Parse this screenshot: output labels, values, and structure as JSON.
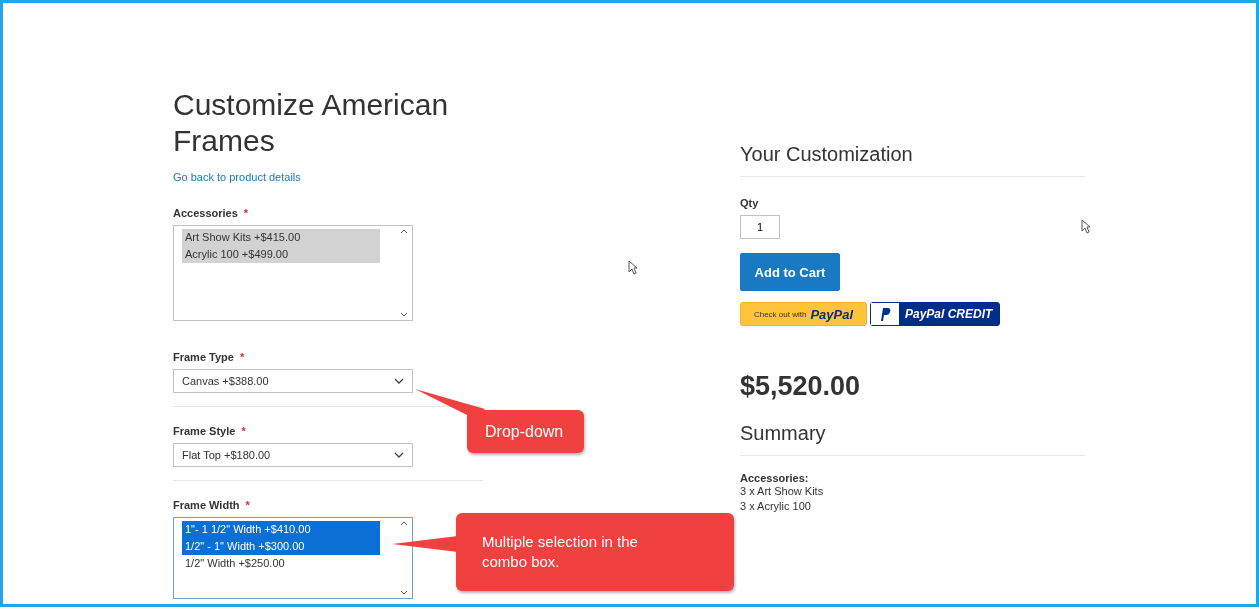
{
  "title": "Customize American Frames",
  "back_link": "Go back to product details",
  "options": [
    {
      "kind": "listbox",
      "label": "Accessories",
      "required": "*",
      "focused": false,
      "items": [
        {
          "text": "Art Show Kits +$415.00",
          "selected": true
        },
        {
          "text": "Acrylic 100 +$499.00",
          "selected": true
        }
      ]
    },
    {
      "kind": "select",
      "label": "Frame Type",
      "required": "*",
      "value": "Canvas +$388.00"
    },
    {
      "kind": "select",
      "label": "Frame Style",
      "required": "*",
      "value": "Flat Top +$180.00"
    },
    {
      "kind": "listbox",
      "label": "Frame Width",
      "required": "*",
      "focused": true,
      "items": [
        {
          "text": "1\"- 1 1/2\" Width +$410.00",
          "selected": true
        },
        {
          "text": "1/2\" - 1\" Width +$300.00",
          "selected": true
        },
        {
          "text": "1/2\" Width +$250.00",
          "selected": false
        }
      ]
    }
  ],
  "customization": {
    "heading": "Your Customization",
    "qty_label": "Qty",
    "qty_value": "1",
    "add_button": "Add to Cart",
    "paypal_checkout": {
      "prefix": "Check out with",
      "brand": "PayPal"
    },
    "paypal_credit": "PayPal CREDIT",
    "price": "$5,520.00",
    "summary_heading": "Summary",
    "summary_label": "Accessories:",
    "summary_lines": [
      "3 x Art Show Kits",
      "3 x Acrylic 100"
    ]
  },
  "callouts": [
    {
      "text": "Drop-down"
    },
    {
      "text": "Multiple selection in the combo box."
    }
  ]
}
